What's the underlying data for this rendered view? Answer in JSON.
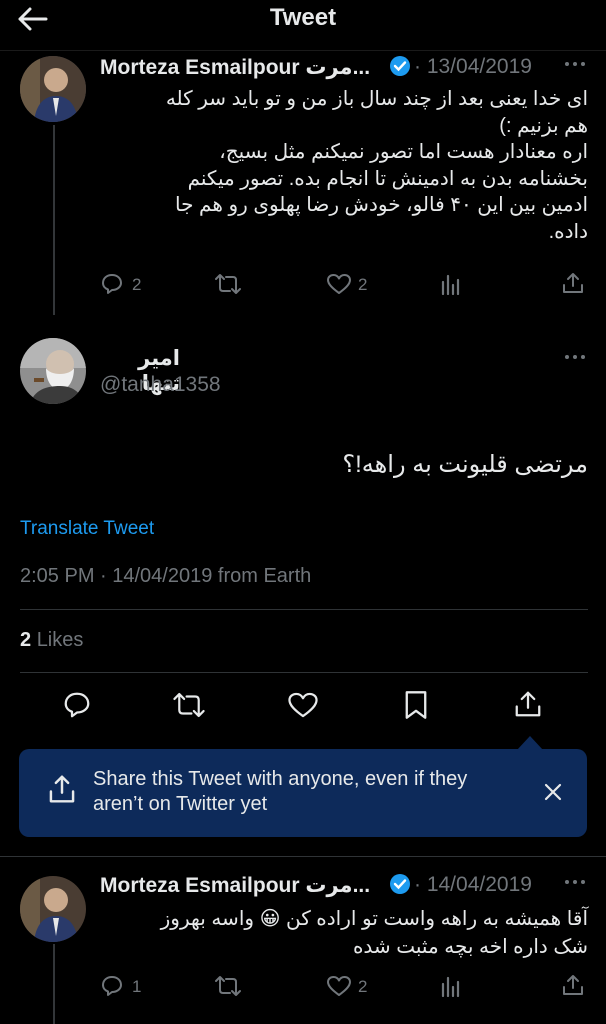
{
  "header": {
    "title": "Tweet"
  },
  "tweet1": {
    "author": "Morteza Esmailpour مرت...",
    "date": "13/04/2019",
    "lines": [
      "ای خدا یعنی بعد از چند سال باز من و تو باید سر کله",
      "هم بزنیم :)",
      "اره معنادار هست اما تصور نمیکنم مثل بسیج،",
      "بخشنامه بدن به ادمینش تا انجام بده. تصور میکنم",
      "ادمین بین این ۴۰ فالو، خودش رضا پهلوی رو هم جا",
      "داده."
    ],
    "replies": "2",
    "likes": "2"
  },
  "main": {
    "display_name": "امیر تنها",
    "handle": "@tanha1358",
    "text": "مرتضی قلیونت به راهه!؟",
    "translate": "Translate Tweet",
    "timestamp": "2:05 PM · 14/04/2019 from Earth",
    "likes_count": "2",
    "likes_label": "Likes"
  },
  "share_tip": {
    "line1": "Share this Tweet with anyone, even if they",
    "line2": "aren’t on Twitter yet"
  },
  "tweet2": {
    "author": "Morteza Esmailpour مرت...",
    "date": "14/04/2019",
    "line1": "آقا همیشه به راهه واست تو اراده کن 😀 واسه بهروز",
    "line2": "شک داره اخه بچه مثبت شده",
    "replies": "1",
    "likes": "2"
  },
  "colors": {
    "verified": "#1d9bf0",
    "link": "#1d9bf0",
    "tooltip_bg": "#0d2a5a"
  }
}
